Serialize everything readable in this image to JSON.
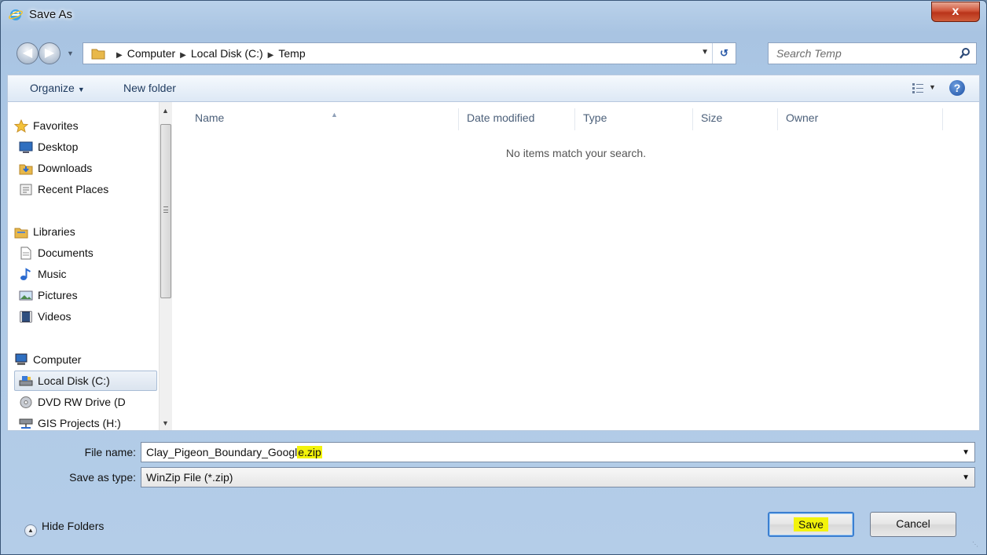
{
  "window": {
    "title": "Save As",
    "close_label": "x"
  },
  "address": {
    "crumbs": [
      "Computer",
      "Local Disk (C:)",
      "Temp"
    ],
    "search_placeholder": "Search Temp"
  },
  "toolbar": {
    "organize_label": "Organize",
    "new_folder_label": "New folder"
  },
  "nav": {
    "groups": [
      {
        "label": "Favorites",
        "icon": "star-icon"
      },
      {
        "label": "Libraries",
        "icon": "libraries-icon"
      },
      {
        "label": "Computer",
        "icon": "computer-icon"
      }
    ],
    "items": [
      {
        "label": "Desktop",
        "icon": "desktop-icon"
      },
      {
        "label": "Downloads",
        "icon": "downloads-icon"
      },
      {
        "label": "Recent Places",
        "icon": "recent-places-icon"
      },
      {
        "label": "Documents",
        "icon": "document-icon"
      },
      {
        "label": "Music",
        "icon": "music-icon"
      },
      {
        "label": "Pictures",
        "icon": "pictures-icon"
      },
      {
        "label": "Videos",
        "icon": "videos-icon"
      },
      {
        "label": "Local Disk (C:)",
        "icon": "drive-icon",
        "selected": true
      },
      {
        "label": "DVD RW Drive (D",
        "icon": "dvd-icon"
      },
      {
        "label": "GIS Projects (H:)",
        "icon": "network-drive-icon"
      }
    ]
  },
  "columns": [
    "Name",
    "Date modified",
    "Type",
    "Size",
    "Owner"
  ],
  "empty_message": "No items match your search.",
  "form": {
    "file_name_label": "File name:",
    "file_name_value": "Clay_Pigeon_Boundary_Googl",
    "file_name_highlighted": "e.zip",
    "save_as_type_label": "Save as type:",
    "save_as_type_value": "WinZip File (*.zip)"
  },
  "buttons": {
    "hide_folders": "Hide Folders",
    "save": "Save",
    "cancel": "Cancel"
  },
  "colors": {
    "highlight": "#f3f30a",
    "accent": "#3b7fd1"
  }
}
